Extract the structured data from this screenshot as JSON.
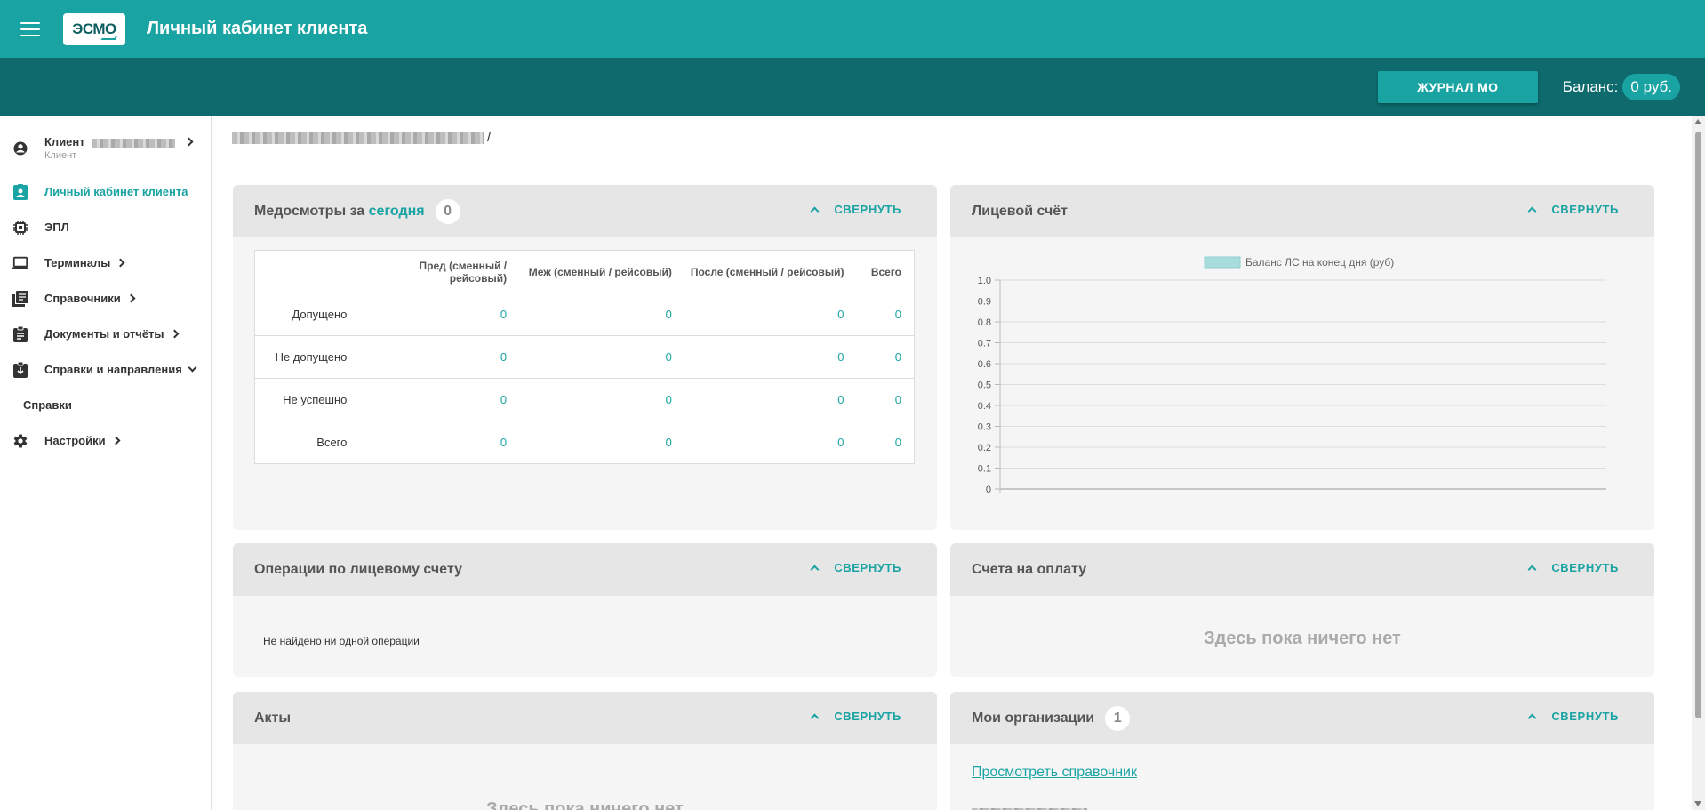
{
  "header": {
    "title": "Личный кабинет клиента",
    "logo_text": "ЭСМО",
    "journal_button": "ЖУРНАЛ МО",
    "balance_label": "Баланс:",
    "balance_value": "0 руб."
  },
  "sidebar": {
    "client_name": "Клиент",
    "client_role": "Клиент",
    "items": [
      {
        "label": "Личный кабинет клиента",
        "icon": "badge-icon",
        "active": true
      },
      {
        "label": "ЭПЛ",
        "icon": "chip-icon"
      },
      {
        "label": "Терминалы",
        "icon": "laptop-icon"
      },
      {
        "label": "Справочники",
        "icon": "book-icon"
      },
      {
        "label": "Документы и отчёты",
        "icon": "clipboard-icon"
      },
      {
        "label": "Справки и направления",
        "icon": "clipboard-download-icon"
      },
      {
        "label": "Справки",
        "icon": ""
      },
      {
        "label": "Настройки",
        "icon": "gear-icon"
      }
    ]
  },
  "breadcrumb": {
    "separator": "/"
  },
  "collapse_label": "СВЕРНУТЬ",
  "medcheck": {
    "title_prefix": "Медосмотры за",
    "title_accent": "сегодня",
    "count": "0",
    "columns": [
      "",
      "Пред (сменный / рейсовый)",
      "Меж (сменный / рейсовый)",
      "После (сменный / рейсовый)",
      "Всего"
    ],
    "rows": [
      {
        "label": "Допущено",
        "values": [
          "0",
          "0",
          "0",
          "0"
        ]
      },
      {
        "label": "Не допущено",
        "values": [
          "0",
          "0",
          "0",
          "0"
        ]
      },
      {
        "label": "Не успешно",
        "values": [
          "0",
          "0",
          "0",
          "0"
        ]
      },
      {
        "label": "Всего",
        "values": [
          "0",
          "0",
          "0",
          "0"
        ]
      }
    ]
  },
  "account": {
    "title": "Лицевой счёт"
  },
  "chart_data": {
    "type": "bar",
    "categories": [],
    "series": [
      {
        "name": "Баланс ЛС на конец дня (руб)",
        "values": []
      }
    ],
    "title": "",
    "xlabel": "",
    "ylabel": "",
    "ylim": [
      0,
      1.0
    ],
    "yticks": [
      "1.0",
      "0.9",
      "0.8",
      "0.7",
      "0.6",
      "0.5",
      "0.4",
      "0.3",
      "0.2",
      "0.1",
      "0"
    ],
    "grid": true,
    "legend": "top-center",
    "legend_color": "#a8dcdc"
  },
  "operations": {
    "title": "Операции по лицевому счету",
    "empty_text": "Не найдено ни одной операции"
  },
  "invoices": {
    "title": "Счета на оплату",
    "empty_text": "Здесь пока ничего нет"
  },
  "acts": {
    "title": "Акты",
    "empty_text": "Здесь пока ничего нет"
  },
  "orgs": {
    "title": "Мои организации",
    "count": "1",
    "link_text": "Просмотреть справочник"
  },
  "colors": {
    "primary": "#1aa3a3",
    "dark": "#0e6a6c"
  }
}
